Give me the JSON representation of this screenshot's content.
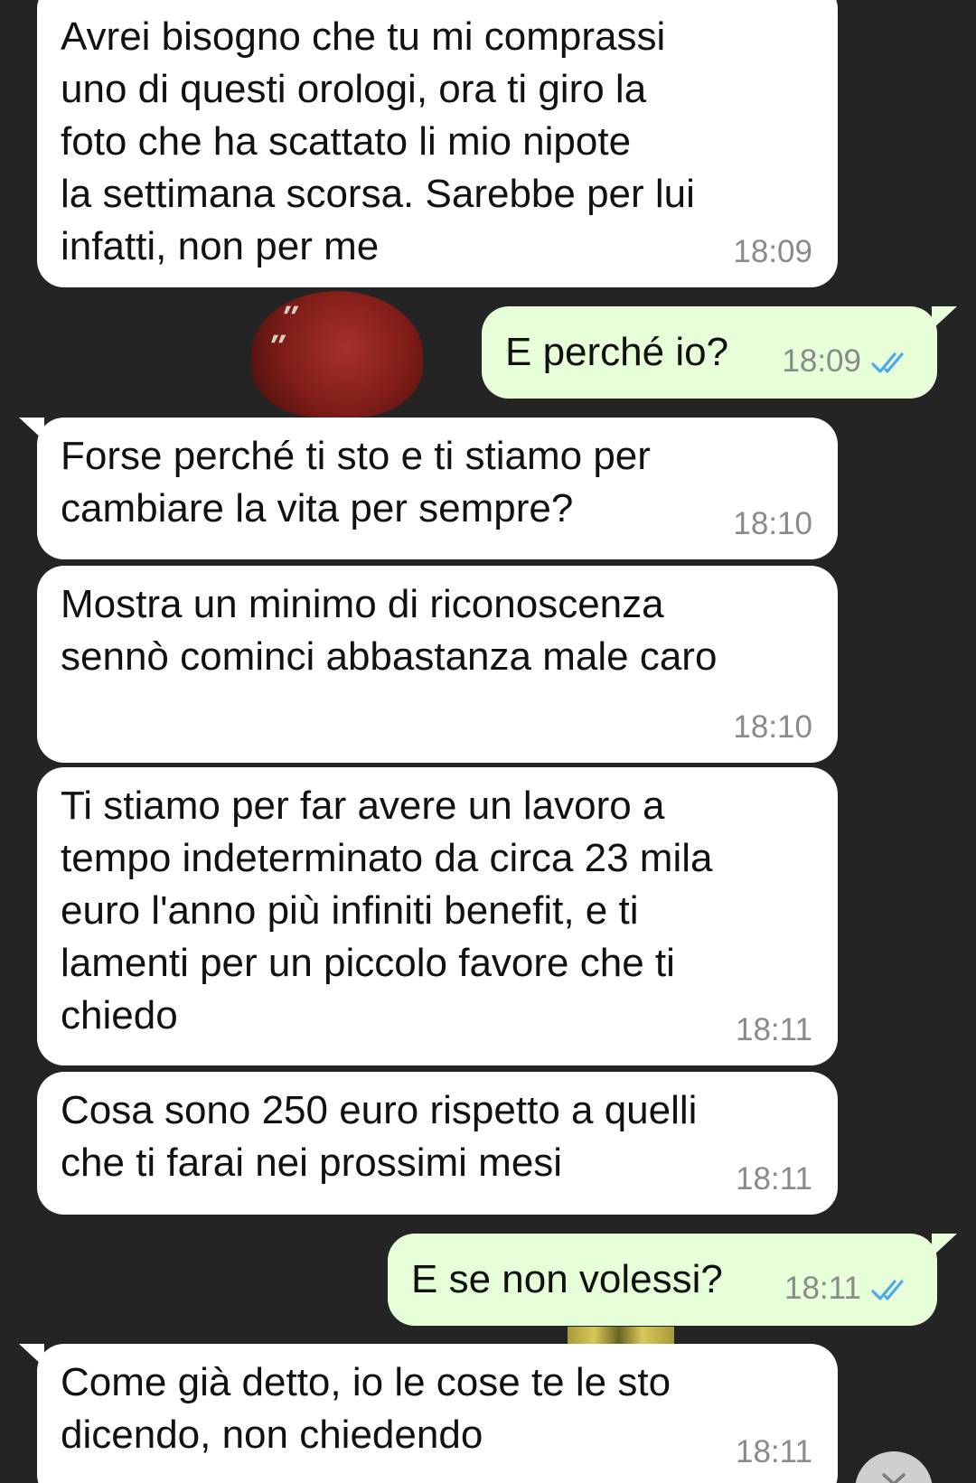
{
  "conversation": {
    "messages": [
      {
        "direction": "incoming",
        "text": "Avrei bisogno che tu mi comprassi\nuno di questi orologi, ora ti giro la\nfoto che ha scattato li mio nipote\nla settimana scorsa. Sarebbe per lui\ninfatti, non per me",
        "time": "18:09"
      },
      {
        "direction": "outgoing",
        "text": "E perché io?",
        "time": "18:09",
        "status_icon": "double-check-read-icon"
      },
      {
        "direction": "incoming",
        "text": "Forse perché ti sto e ti stiamo per\ncambiare la vita per sempre?",
        "time": "18:10"
      },
      {
        "direction": "incoming",
        "text": "Mostra un minimo di riconoscenza\nsennò cominci abbastanza male caro",
        "time": "18:10"
      },
      {
        "direction": "incoming",
        "text": "Ti stiamo per far avere un lavoro a\ntempo indeterminato da circa 23 mila\neuro l'anno più infiniti benefit, e ti\nlamenti per un piccolo favore che ti\nchiedo",
        "time": "18:11"
      },
      {
        "direction": "incoming",
        "text": "Cosa sono 250 euro rispetto a quelli\nche ti farai nei prossimi mesi",
        "time": "18:11"
      },
      {
        "direction": "outgoing",
        "text": "E se non volessi?",
        "time": "18:11",
        "status_icon": "double-check-read-icon"
      },
      {
        "direction": "incoming",
        "text": "Come già detto, io le cose te le sto\ndicendo, non chiedendo",
        "time": "18:11"
      }
    ]
  },
  "colors": {
    "background": "#242424",
    "incoming_bubble": "#ffffff",
    "outgoing_bubble": "#e7ffd9",
    "timestamp": "#8a8a8a",
    "read_ticks": "#4fa8e8"
  },
  "scroll_button": {
    "icon": "chevron-down-icon"
  }
}
